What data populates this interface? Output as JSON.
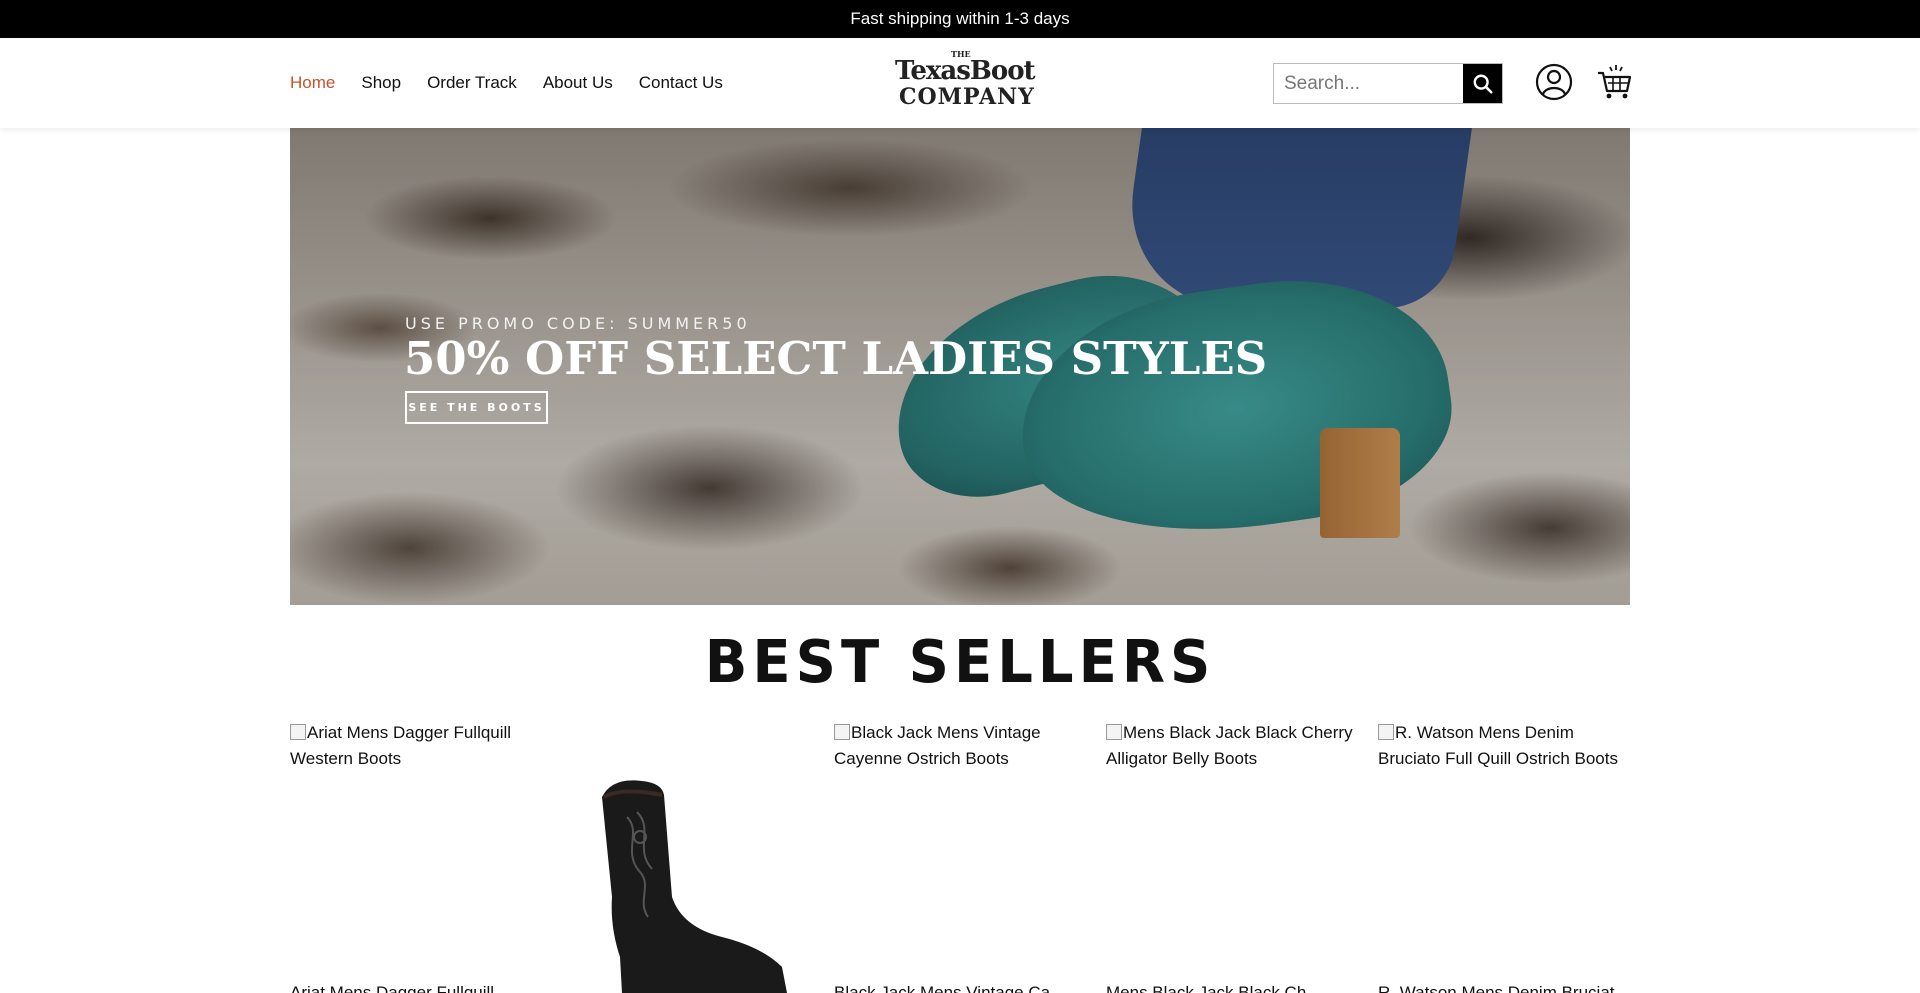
{
  "announcement": "Fast shipping within 1-3 days",
  "nav": {
    "items": [
      {
        "label": "Home",
        "active": true
      },
      {
        "label": "Shop",
        "active": false
      },
      {
        "label": "Order Track",
        "active": false
      },
      {
        "label": "About Us",
        "active": false
      },
      {
        "label": "Contact Us",
        "active": false
      }
    ]
  },
  "logo": {
    "the": "THE",
    "line1": "TexasBoot",
    "line2": "COMPANY"
  },
  "search": {
    "placeholder": "Search..."
  },
  "hero": {
    "promo": "USE PROMO CODE: SUMMER50",
    "title": "50% OFF SELECT LADIES STYLES",
    "button": "SEE THE BOOTS"
  },
  "best_sellers": {
    "title": "BEST SELLERS",
    "products": [
      {
        "alt": "Ariat Mens Dagger Fullquill Western Boots",
        "cut": "Ariat Mens Dagger Fullquill"
      },
      {
        "alt": "",
        "cut": ""
      },
      {
        "alt": "Black Jack Mens Vintage Cayenne Ostrich Boots",
        "cut": "Black Jack Mens Vintage Ca"
      },
      {
        "alt": "Mens Black Jack Black Cherry Alligator Belly Boots",
        "cut": "Mens Black Jack Black Ch"
      },
      {
        "alt": "R. Watson Mens Denim Bruciato Full Quill Ostrich Boots",
        "cut": "R. Watson Mens Denim Bruciat"
      }
    ]
  },
  "colors": {
    "accent": "#c8522a",
    "announce_bg": "#000000"
  }
}
